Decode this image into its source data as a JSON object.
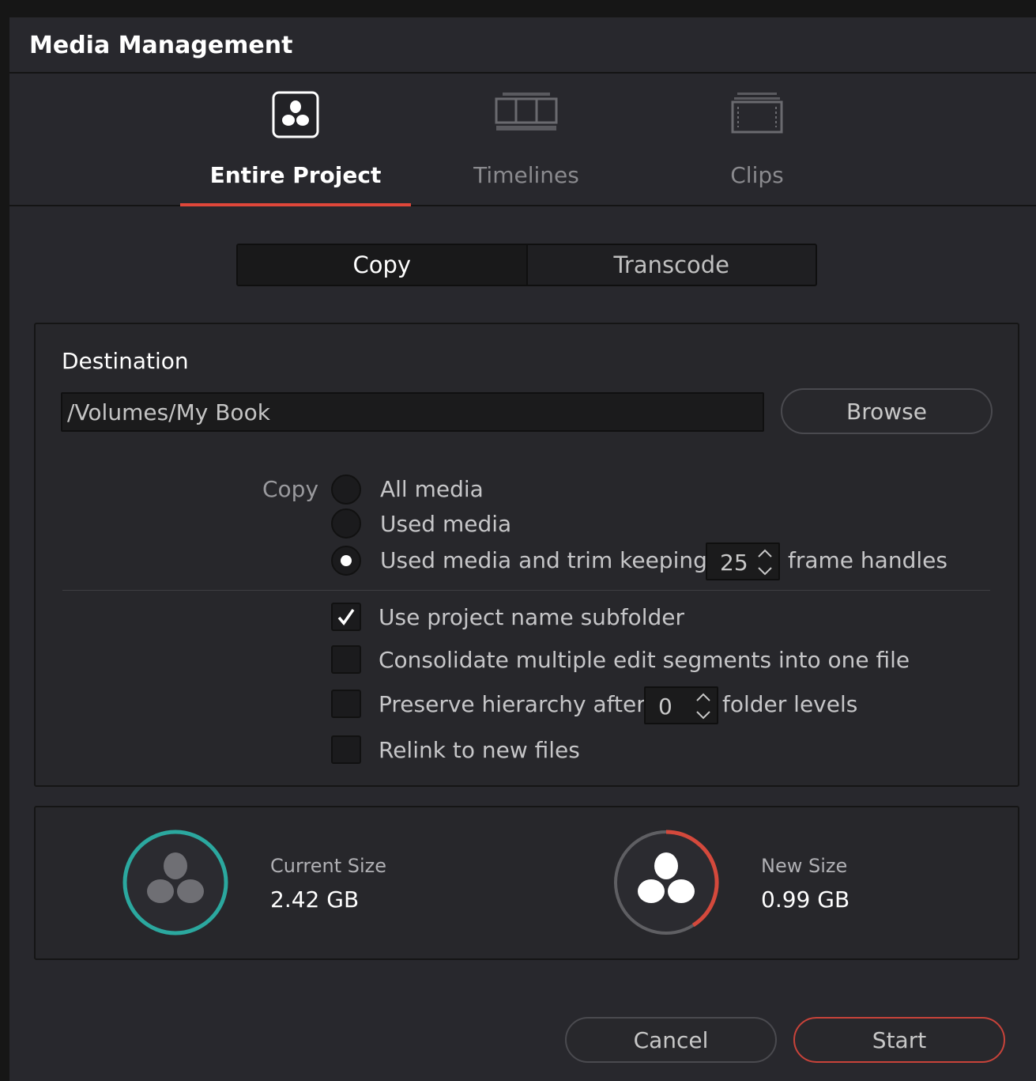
{
  "window": {
    "title": "Media Management"
  },
  "modes": [
    {
      "label": "Entire Project",
      "icon": "resolve-logo-icon",
      "active": true
    },
    {
      "label": "Timelines",
      "icon": "timeline-icon",
      "active": false
    },
    {
      "label": "Clips",
      "icon": "clip-icon",
      "active": false
    }
  ],
  "segment": {
    "copy_label": "Copy",
    "transcode_label": "Transcode",
    "selected": "Copy"
  },
  "destination": {
    "label": "Destination",
    "path": "/Volumes/My Book",
    "browse_label": "Browse"
  },
  "copy_options": {
    "label": "Copy",
    "all_media": "All media",
    "used_media": "Used media",
    "used_trim": "Used media and trim keeping",
    "handles_value": "25",
    "handles_suffix": "frame handles",
    "selected": "Used media and trim keeping"
  },
  "checkboxes": {
    "subfolder": {
      "label": "Use project name subfolder",
      "checked": true
    },
    "consolidate": {
      "label": "Consolidate multiple edit segments into one file",
      "checked": false
    },
    "preserve": {
      "label": "Preserve hierarchy after",
      "value": "0",
      "suffix": "folder levels",
      "checked": false
    },
    "relink": {
      "label": "Relink to new files",
      "checked": false
    }
  },
  "sizes": {
    "current_label": "Current Size",
    "current_value": "2.42 GB",
    "new_label": "New Size",
    "new_value": "0.99 GB",
    "new_ratio": 0.41,
    "current_ring_color": "#2ba89f",
    "new_ring_color": "#d4493c"
  },
  "footer": {
    "cancel_label": "Cancel",
    "start_label": "Start"
  }
}
